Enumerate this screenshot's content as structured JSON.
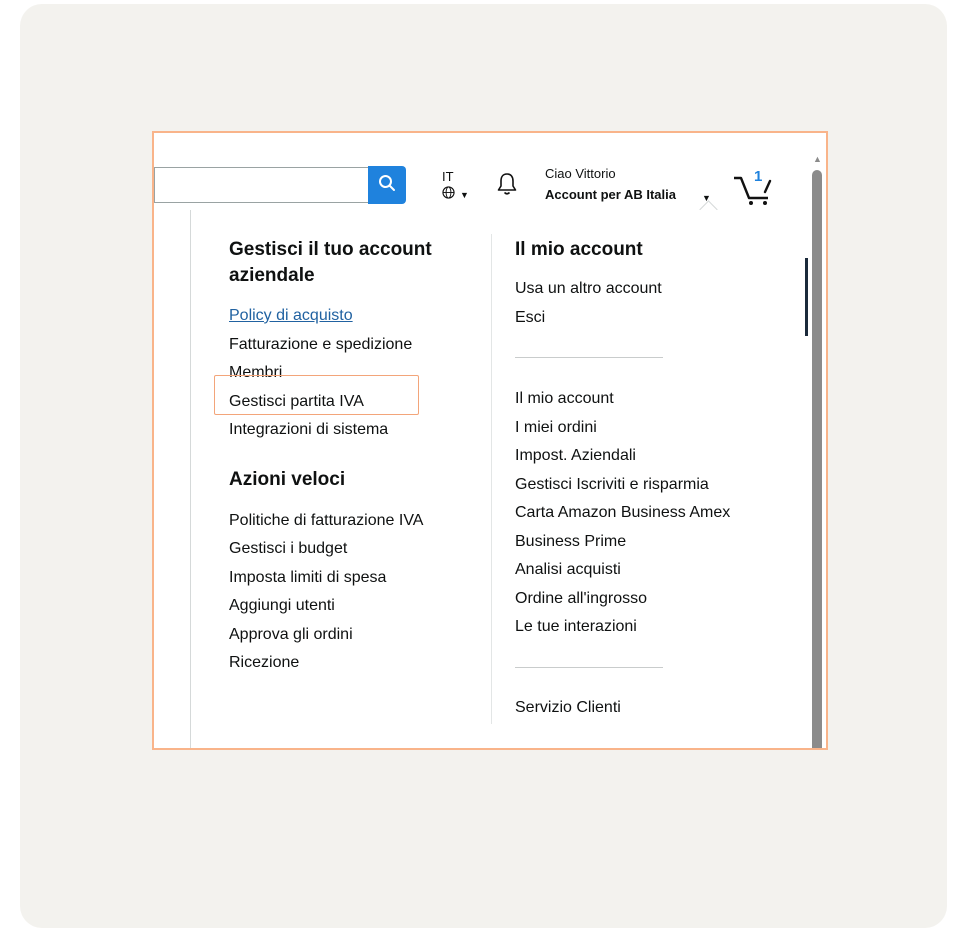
{
  "header": {
    "language_code": "IT",
    "greeting": "Ciao Vittorio",
    "account_label": "Account per AB Italia",
    "cart_count": "1"
  },
  "left_column": {
    "section1_heading": "Gestisci il tuo account aziendale",
    "section1_items": [
      "Policy di acquisto",
      "Fatturazione e spedizione",
      "Membri",
      "Gestisci partita IVA",
      "Integrazioni di sistema"
    ],
    "section2_heading": "Azioni veloci",
    "section2_items": [
      "Politiche di fatturazione IVA",
      "Gestisci i budget",
      "Imposta limiti di spesa",
      "Aggiungi utenti",
      "Approva gli ordini",
      "Ricezione"
    ]
  },
  "right_column": {
    "heading": "Il mio account",
    "group1": [
      "Usa un altro account",
      "Esci"
    ],
    "group2": [
      "Il mio account",
      "I miei ordini",
      "Impost. Aziendali",
      "Gestisci Iscriviti e risparmia",
      "Carta Amazon Business Amex",
      "Business Prime",
      "Analisi acquisti",
      "Ordine all'ingrosso",
      "Le tue interazioni"
    ],
    "group3": [
      "Servizio Clienti"
    ]
  },
  "colors": {
    "accent": "#1f82dd",
    "highlight": "#f3a57a",
    "link": "#2162a1"
  }
}
